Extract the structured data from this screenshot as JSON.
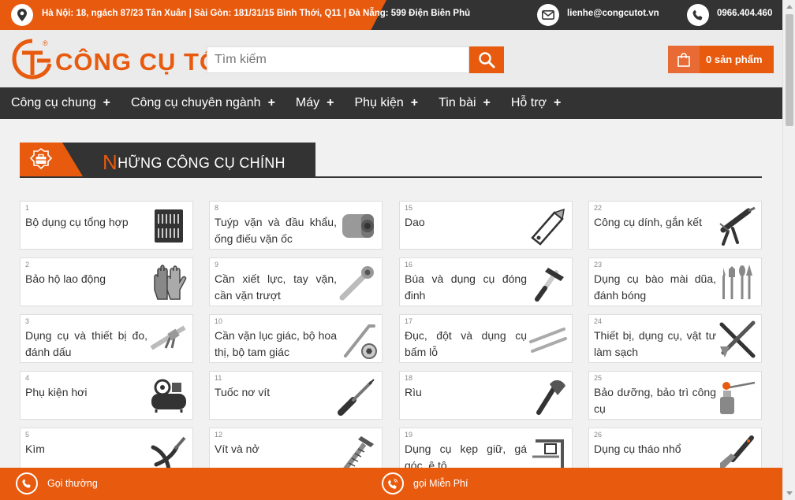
{
  "topbar": {
    "address": "Hà Nội: 18, ngách 87/23 Tân Xuân | Sài Gòn: 181/31/15 Bình Thới, Q11 | Đà Nẵng: 599 Điện Biên Phủ",
    "email": "lienhe@congcutot.vn",
    "phone": "0966.404.460",
    "icons": [
      "location-icon",
      "mail-icon",
      "phone-icon"
    ]
  },
  "header": {
    "brand": "CÔNG CỤ TỐT",
    "registered": "®",
    "search_placeholder": "Tìm kiếm",
    "cart_label": "0 sản phẩm"
  },
  "nav": {
    "items": [
      {
        "label": "Công cụ chung",
        "plus": "+"
      },
      {
        "label": "Công cụ chuyên ngành",
        "plus": "+"
      },
      {
        "label": "Máy",
        "plus": "+"
      },
      {
        "label": "Phụ kiện",
        "plus": "+"
      },
      {
        "label": "Tin bài",
        "plus": "+"
      },
      {
        "label": "Hỗ trợ",
        "plus": "+"
      }
    ]
  },
  "section": {
    "title_first": "N",
    "title_rest": "HỮNG CÔNG CỤ CHÍNH"
  },
  "categories": [
    {
      "num": "1",
      "label": "Bộ dụng cụ tổng hợp",
      "icon": "toolbox-set-icon"
    },
    {
      "num": "8",
      "label": "Tuýp vặn và đầu khẩu, ống điếu vặn ốc",
      "icon": "socket-icon"
    },
    {
      "num": "15",
      "label": "Dao",
      "icon": "utility-knife-icon"
    },
    {
      "num": "22",
      "label": "Công cụ dính, gắn kết",
      "icon": "caulking-gun-icon"
    },
    {
      "num": "2",
      "label": "Bảo hộ lao động",
      "icon": "gloves-icon"
    },
    {
      "num": "9",
      "label": "Cần xiết lực, tay vặn, cần vặn trượt",
      "icon": "ratchet-icon"
    },
    {
      "num": "16",
      "label": "Búa và dụng cụ đóng đinh",
      "icon": "hammer-icon"
    },
    {
      "num": "23",
      "label": "Dụng cụ bào mài dũa, đánh bóng",
      "icon": "burr-bits-icon"
    },
    {
      "num": "3",
      "label": "Dụng cụ và thiết bị đo, đánh dấu",
      "icon": "caliper-icon"
    },
    {
      "num": "10",
      "label": "Cần vặn lục giác, bộ hoa thị, bộ tam giác",
      "icon": "hex-key-icon"
    },
    {
      "num": "17",
      "label": "Đục, đột và dụng cụ bấm lỗ",
      "icon": "chisel-icon"
    },
    {
      "num": "24",
      "label": "Thiết bị, dụng cụ, vật tư làm sạch",
      "icon": "cleaning-tools-icon"
    },
    {
      "num": "4",
      "label": "Phụ kiện hơi",
      "icon": "air-compressor-icon"
    },
    {
      "num": "11",
      "label": "Tuốc nơ vít",
      "icon": "screwdriver-icon"
    },
    {
      "num": "18",
      "label": "Rìu",
      "icon": "axe-icon"
    },
    {
      "num": "25",
      "label": "Bảo dưỡng, bảo trì công cụ",
      "icon": "oil-can-icon"
    },
    {
      "num": "5",
      "label": "Kìm",
      "icon": "pliers-icon"
    },
    {
      "num": "12",
      "label": "Vít và nở",
      "icon": "screw-icon"
    },
    {
      "num": "19",
      "label": "Dụng cụ kẹp giữ, gá góc, ê tô",
      "icon": "clamp-icon"
    },
    {
      "num": "26",
      "label": "Dụng cụ tháo nhổ",
      "icon": "scraper-icon"
    }
  ],
  "bottom": {
    "call_normal": "Gọi thường",
    "call_free": "gọi Miễn Phí"
  },
  "colors": {
    "accent": "#e85a0e",
    "dark": "#333333",
    "background": "#f1f1f1"
  }
}
